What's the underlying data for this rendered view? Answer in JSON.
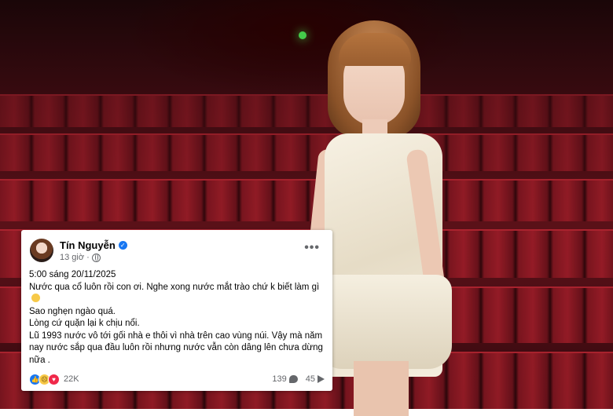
{
  "post": {
    "author": "Tín Nguyễn",
    "time": "13 giờ",
    "lines": [
      "5:00 sáng 20/11/2025",
      "Nước qua cổ luôn rồi con ơi. Nghe xong nước mắt trào chứ k biết làm gì",
      "Sao nghẹn ngào quá.",
      "Lòng cứ quặn lại k chịu nổi.",
      "Lũ 1993 nước vô tới gối nhà e thôi vì nhà trên cao vùng núi. Vậy mà năm nay nước sắp qua đầu luôn rồi nhưng nước vẫn còn dâng lên chưa dừng nữa ."
    ],
    "reaction_count": "22K",
    "comment_count": "139",
    "share_count": "45",
    "reactions": [
      "like-icon",
      "sad-icon",
      "love-icon"
    ]
  },
  "colors": {
    "facebook_blue": "#1877f2",
    "meta_gray": "#65676b",
    "text": "#050505",
    "seat_red": "#9b1d28"
  }
}
